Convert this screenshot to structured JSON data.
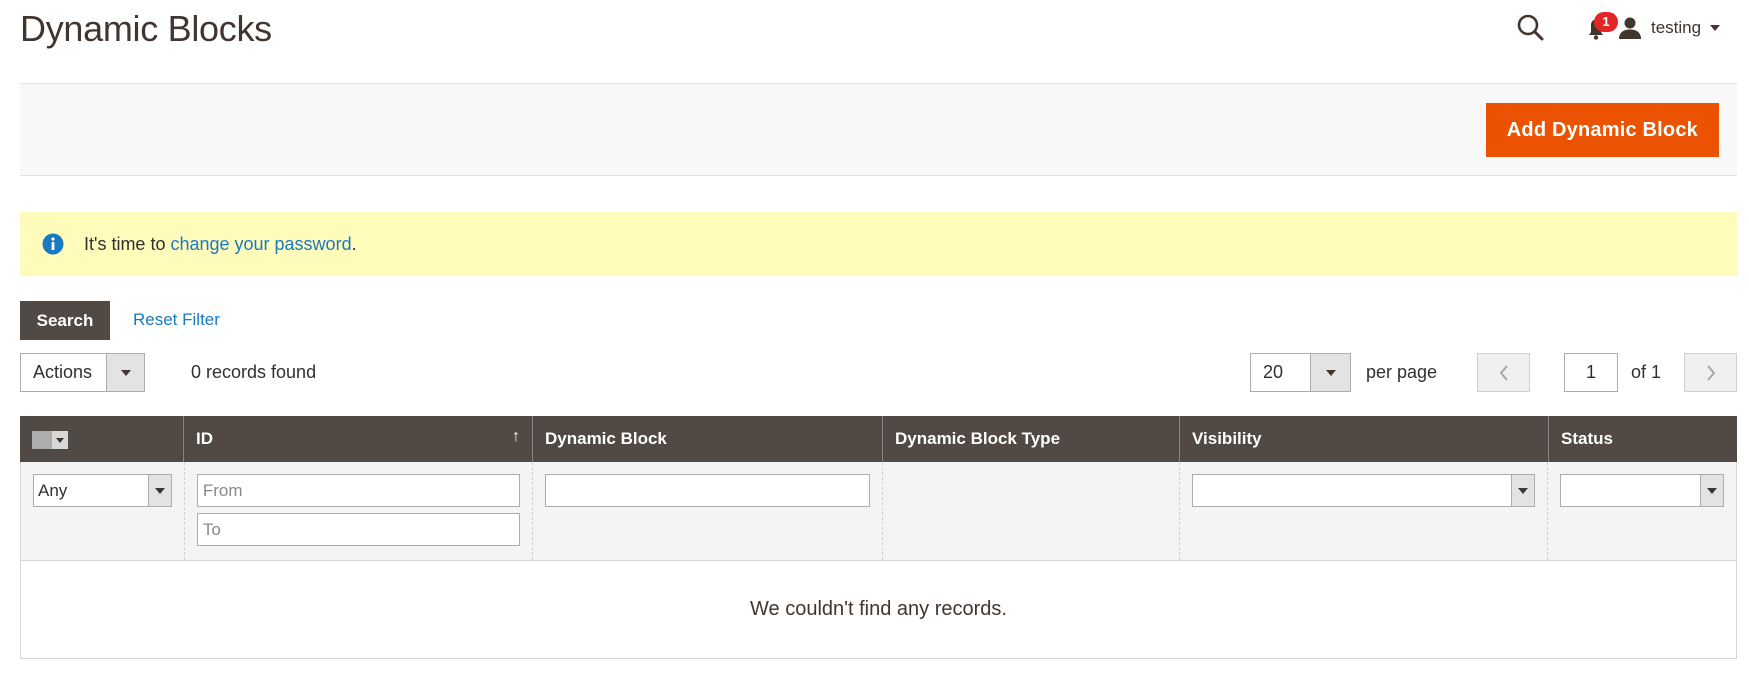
{
  "page": {
    "title": "Dynamic Blocks"
  },
  "header": {
    "notifications_count": "1",
    "username": "testing"
  },
  "action_bar": {
    "add_button_label": "Add Dynamic Block"
  },
  "message": {
    "text_before": "It's time to ",
    "link_text": "change your password",
    "text_after": "."
  },
  "filters_bar": {
    "search_label": "Search",
    "reset_label": "Reset Filter"
  },
  "toolbar": {
    "actions_label": "Actions",
    "records_text": "0 records found",
    "per_page_value": "20",
    "per_page_label": "per page",
    "current_page": "1",
    "total_pages_text": "of 1"
  },
  "grid": {
    "columns": [
      "ID",
      "Dynamic Block",
      "Dynamic Block Type",
      "Visibility",
      "Status"
    ],
    "sort_indicator": "↑",
    "filters": {
      "mass_any": "Any",
      "id_from_placeholder": "From",
      "id_to_placeholder": "To"
    },
    "empty_text": "We couldn't find any records."
  },
  "colors": {
    "accent_orange": "#eb5202",
    "header_dark": "#514943",
    "link_blue": "#1979c3",
    "message_yellow": "#fffbbb",
    "notification_red": "#e22626"
  },
  "icons": [
    "search-icon",
    "bell-icon",
    "user-icon",
    "info-icon",
    "chevron-left-icon",
    "chevron-right-icon"
  ]
}
